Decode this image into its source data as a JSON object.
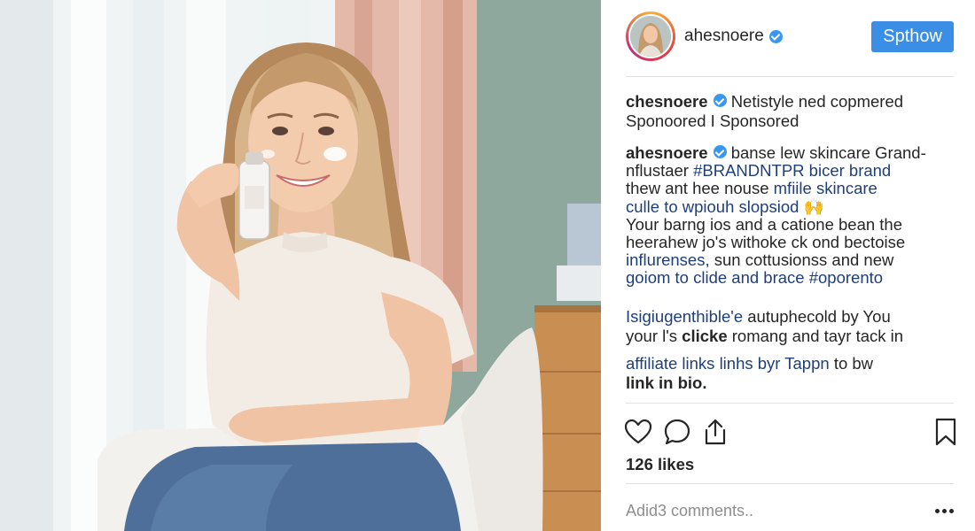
{
  "post": {
    "header": {
      "username": "ahesnoere",
      "follow_label": "Spthow"
    },
    "caption_top": {
      "username": "chesnoere",
      "text": "Netistyle ned copmered",
      "sponsored_line": "Sponoored I Sponsored"
    },
    "body": {
      "username": "ahesnoere",
      "intro": "banse lew skincare Grand-",
      "line2_prefix": "nflustaer",
      "line2_tag": "#BRANDNTPR",
      "line2_rest": "bicer brand",
      "line3_a": "thew ant hee nouse",
      "line3_link": "mfiile skincare",
      "line4_link": "culle to wpiouh slopsiod",
      "line4_emoji": "🙌",
      "line5": "Your barng ios and a catione bean the",
      "line6": "heerahew jo's withoke ck ond bectoise",
      "line7_link": "influrenses,",
      "line7_rest": "sun cottusionss and new",
      "line8_link": "goiom",
      "line8_mid": "to clide and brace",
      "line8_tag": "#oporento"
    },
    "para2": {
      "line1_link": "Isigiugenthible'e",
      "line1_rest": "autuphecold by You",
      "line2_a": "your l's",
      "line2_bold": "clicke",
      "line2_rest": "romang and tayr tack in"
    },
    "para3": {
      "line1_link": "affiliate links linhs byr Tappn",
      "line1_rest": "to bw",
      "line2_bold": "link in bio."
    },
    "actions": {
      "like_icon": "heart-icon",
      "comment_icon": "comment-icon",
      "share_icon": "share-icon",
      "save_icon": "bookmark-icon"
    },
    "likes_text": "126 likes",
    "comment_placeholder": "Adid3 comments..",
    "more_icon": "more-options-icon"
  },
  "colors": {
    "accent": "#3b8ee6",
    "verified": "#3897f0",
    "link": "#1f3f79",
    "text": "#262626",
    "muted": "#8e8e8e"
  }
}
